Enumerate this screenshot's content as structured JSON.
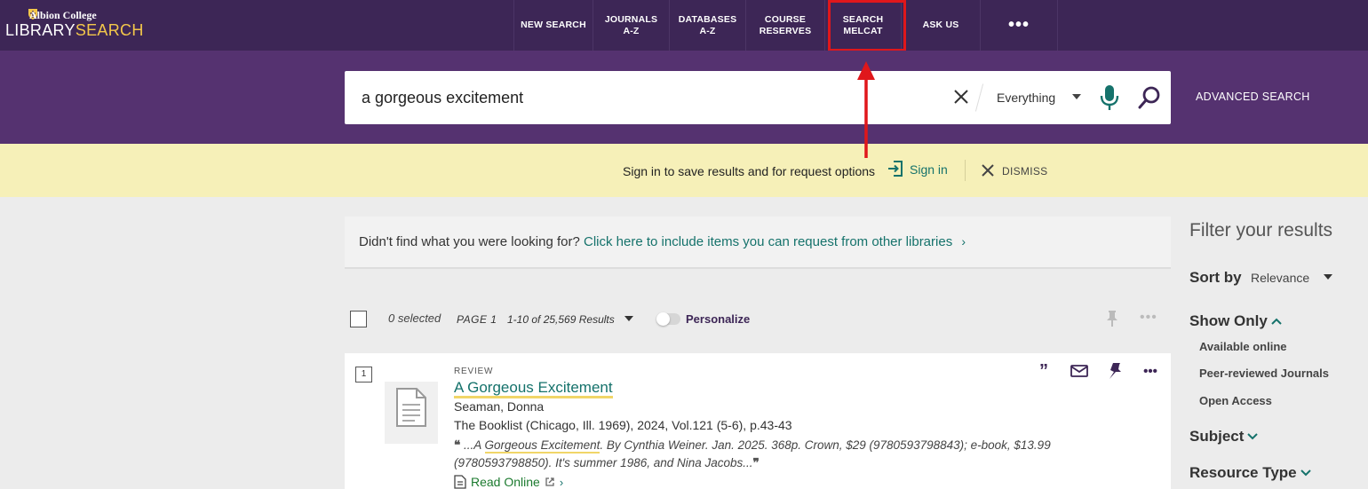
{
  "header": {
    "college": "Albion College",
    "brand_part1": "LIBRARY",
    "brand_part2": "SEARCH",
    "nav": [
      {
        "label": "NEW SEARCH"
      },
      {
        "label": "JOURNALS\nA-Z"
      },
      {
        "label": "DATABASES\nA-Z"
      },
      {
        "label": "COURSE\nRESERVES"
      },
      {
        "label": "SEARCH\nMELCAT"
      },
      {
        "label": "ASK US"
      },
      {
        "label": "•••"
      }
    ]
  },
  "search": {
    "query": "a gorgeous excitement",
    "scope": "Everything",
    "advanced_label": "ADVANCED SEARCH"
  },
  "signin_bar": {
    "message": "Sign in to save results and for request options",
    "signin_label": "Sign in",
    "dismiss_label": "DISMISS"
  },
  "didnt_find": {
    "text": "Didn't find what you were looking for?",
    "link": "Click here to include items you can request from other libraries",
    "chevron": "›"
  },
  "results_bar": {
    "selected": "0 selected",
    "page": "PAGE 1",
    "count": "1-10 of 25,569 Results",
    "personalize": "Personalize",
    "more": "•••"
  },
  "results": [
    {
      "number": "1",
      "type": "REVIEW",
      "title": "A Gorgeous Excitement",
      "author": "Seaman, Donna",
      "source": "The Booklist (Chicago, Ill. 1969), 2024, Vol.121 (5-6), p.43-43",
      "snippet_pre": "...A ",
      "snippet_hl": "Gorgeous Excitement",
      "snippet_post": ". By Cynthia Weiner. Jan. 2025. 368p. Crown, $29 (9780593798843); e-book, $13.99 (9780593798850). It's summer 1986, and Nina Jacobs...",
      "read_online": "Read Online",
      "more": "•••"
    }
  ],
  "filters": {
    "title": "Filter your results",
    "sort_label": "Sort by",
    "sort_value": "Relevance",
    "show_only": "Show Only",
    "show_only_options": [
      "Available online",
      "Peer-reviewed Journals",
      "Open Access"
    ],
    "subject": "Subject",
    "resource_type": "Resource Type"
  },
  "colors": {
    "nav_bg": "#3d2656",
    "search_band": "#553270",
    "teal": "#15726b",
    "signin_bar": "#f6f0b8",
    "annotation_red": "#e0171b"
  }
}
